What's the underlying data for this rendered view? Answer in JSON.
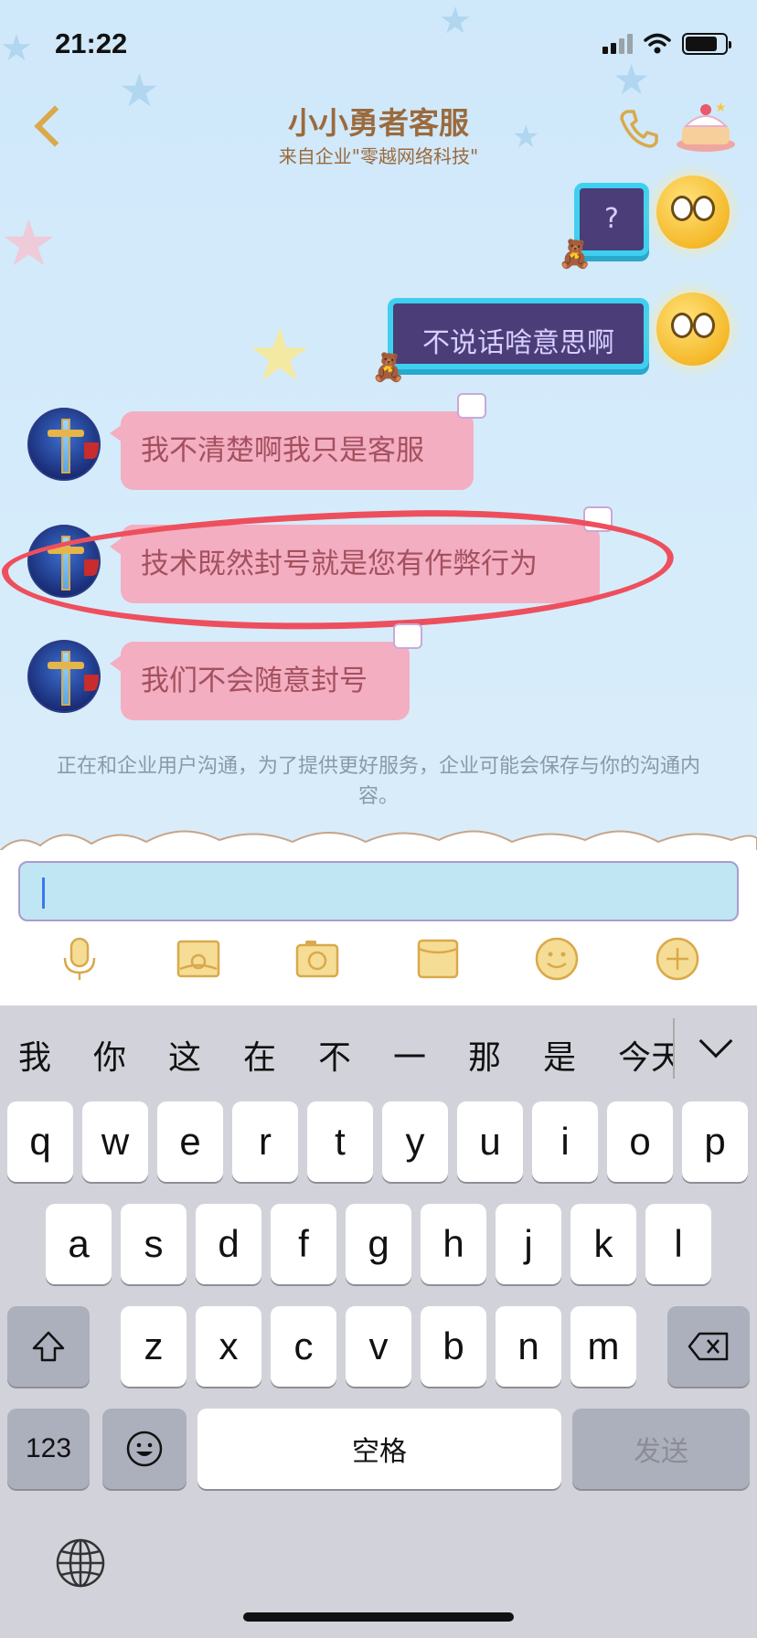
{
  "status_bar": {
    "time": "21:22"
  },
  "header": {
    "title": "小小勇者客服",
    "subtitle": "来自企业\"零越网络科技\"",
    "back_icon": "chevron-left-icon",
    "call_icon": "phone-icon",
    "sticker_icon": "cake-icon",
    "accent_color": "#d9a94b"
  },
  "messages": [
    {
      "side": "out",
      "text": "?"
    },
    {
      "side": "out",
      "text": "不说话啥意思啊"
    },
    {
      "side": "in",
      "text": "我不清楚啊我只是客服"
    },
    {
      "side": "in",
      "text": "技术既然封号就是您有作弊行为",
      "highlighted": true
    },
    {
      "side": "in",
      "text": "我们不会随意封号"
    }
  ],
  "notice": "正在和企业用户沟通，为了提供更好服务，企业可能会保存与你的沟通内容。",
  "input": {
    "value": "",
    "toolbar_icons": [
      "microphone-icon",
      "photo-icon",
      "camera-icon",
      "folder-icon",
      "emoji-icon",
      "plus-icon"
    ]
  },
  "keyboard": {
    "suggestions": [
      "我",
      "你",
      "这",
      "在",
      "不",
      "一",
      "那",
      "是",
      "今天"
    ],
    "row1": [
      "q",
      "w",
      "e",
      "r",
      "t",
      "y",
      "u",
      "i",
      "o",
      "p"
    ],
    "row2": [
      "a",
      "s",
      "d",
      "f",
      "g",
      "h",
      "j",
      "k",
      "l"
    ],
    "row3": [
      "z",
      "x",
      "c",
      "v",
      "b",
      "n",
      "m"
    ],
    "num_key": "123",
    "space_key": "空格",
    "send_key": "发送"
  },
  "colors": {
    "incoming_bubble": "#f3aec1",
    "outgoing_bubble": "#4a3d78",
    "highlight_circle": "#ee4f5d"
  }
}
